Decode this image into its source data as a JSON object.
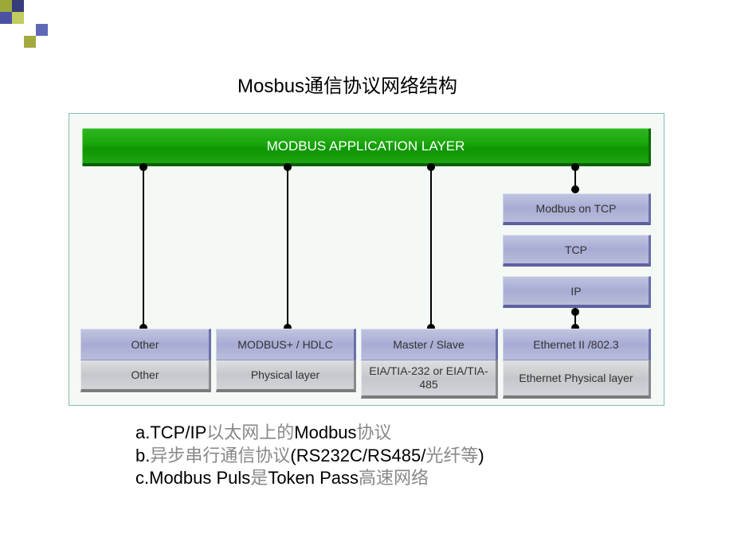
{
  "title": "Mosbus通信协议网络结构",
  "app_layer": "MODBUS APPLICATION LAYER",
  "tcp_stack": {
    "modbus_tcp": "Modbus on TCP",
    "tcp": "TCP",
    "ip": "IP"
  },
  "columns": [
    {
      "top": "Other",
      "bot": "Other"
    },
    {
      "top": "MODBUS+ / HDLC",
      "bot": "Physical layer"
    },
    {
      "top": "Master / Slave",
      "bot": "EIA/TIA-232 or EIA/TIA-485"
    },
    {
      "top": "Ethernet II /802.3",
      "bot": "Ethernet Physical layer"
    }
  ],
  "notes": {
    "a_pre": "a.TCP/IP",
    "a_mid": "以太网上的",
    "a_suf": "Modbus",
    "a_end": "协议",
    "b_pre": "b.",
    "b_mid": "异步串行通信协议",
    "b_suf": "(RS232C/RS485/",
    "b_end": "光纤等",
    "b_par": ")",
    "c_pre": "c.Modbus Puls",
    "c_mid": "是",
    "c_suf": "Token Pass",
    "c_end": "高速网络"
  },
  "deco_colors": [
    "#9ca83a",
    "#373c7a",
    "#ffffff",
    "#ffffff",
    "#4b52a4",
    "#c3cc5e",
    "#ffffff",
    "#ffffff",
    "#ffffff",
    "#ffffff",
    "#ffffff",
    "#5f68b6",
    "#ffffff",
    "#ffffff",
    "#a3aa40",
    "#ffffff"
  ]
}
